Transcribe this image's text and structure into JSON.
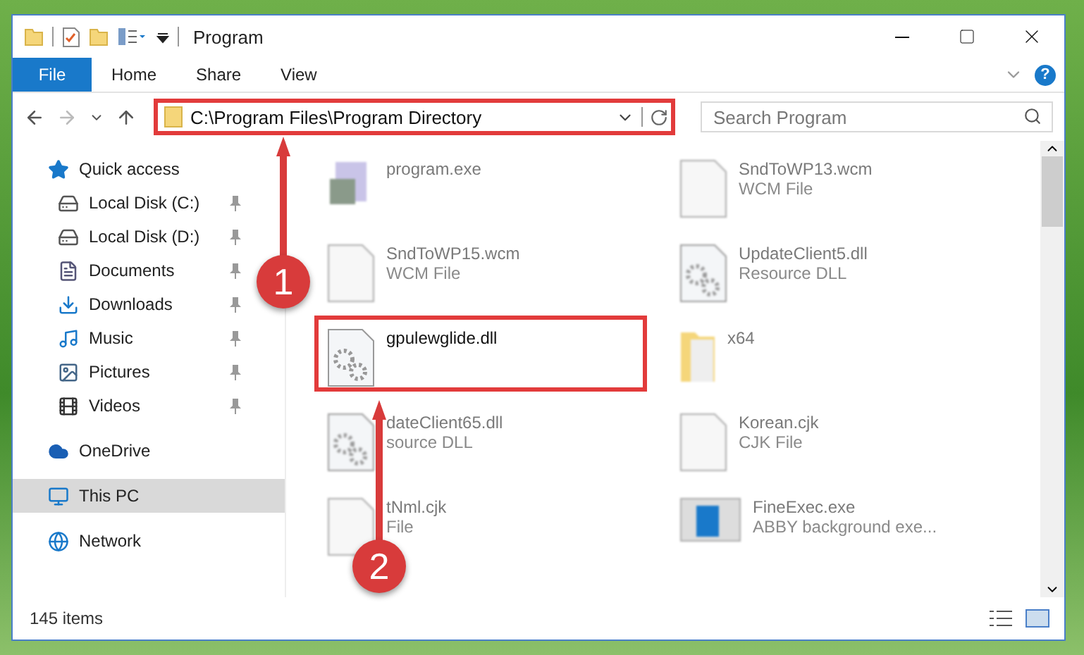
{
  "window": {
    "title": "Program"
  },
  "ribbon": {
    "tabs": [
      {
        "label": "File",
        "selected": true
      },
      {
        "label": "Home",
        "selected": false
      },
      {
        "label": "Share",
        "selected": false
      },
      {
        "label": "View",
        "selected": false
      }
    ],
    "help": "?"
  },
  "address": {
    "path": "C:\\Program Files\\Program Directory",
    "highlighted": true
  },
  "search": {
    "placeholder": "Search Program"
  },
  "nav": [
    {
      "label": "Quick access",
      "kind": "star",
      "selected": false,
      "children": [
        {
          "label": "Local Disk (C:)",
          "kind": "drive-c",
          "pinned": true
        },
        {
          "label": "Local Disk (D:)",
          "kind": "drive",
          "pinned": true
        },
        {
          "label": "Documents",
          "kind": "documents",
          "pinned": true
        },
        {
          "label": "Downloads",
          "kind": "downloads",
          "pinned": true
        },
        {
          "label": "Music",
          "kind": "music",
          "pinned": true
        },
        {
          "label": "Pictures",
          "kind": "pictures",
          "pinned": true
        },
        {
          "label": "Videos",
          "kind": "videos",
          "pinned": true
        }
      ]
    },
    {
      "label": "OneDrive",
      "kind": "cloud",
      "selected": false
    },
    {
      "label": "This PC",
      "kind": "pc",
      "selected": true
    },
    {
      "label": "Network",
      "kind": "network",
      "selected": false
    }
  ],
  "files": [
    {
      "name": "program.exe",
      "kind": "exe",
      "highlighted": false,
      "blurred": true
    },
    {
      "name": "SndToWP13.wcm",
      "type": "WCM File",
      "kind": "file",
      "highlighted": false,
      "blurred": true
    },
    {
      "name": "SndToWP15.wcm",
      "type": "WCM File",
      "kind": "file",
      "highlighted": false,
      "blurred": true
    },
    {
      "name": "UpdateClient5.dll",
      "type": "Resource DLL",
      "kind": "dll",
      "highlighted": false,
      "blurred": true
    },
    {
      "name": "gpulewglide.dll",
      "kind": "dll",
      "highlighted": true,
      "blurred": false
    },
    {
      "name": "x64",
      "kind": "folder",
      "highlighted": false,
      "blurred": true
    },
    {
      "name": "dateClient65.dll",
      "type": "source DLL",
      "kind": "dll",
      "highlighted": false,
      "blurred": true
    },
    {
      "name": "Korean.cjk",
      "type": "CJK File",
      "kind": "file",
      "highlighted": false,
      "blurred": true
    },
    {
      "name": "tNml.cjk",
      "type": "File",
      "kind": "file",
      "highlighted": false,
      "blurred": true
    },
    {
      "name": "FineExec.exe",
      "type": "ABBY background exe...",
      "kind": "app",
      "highlighted": false,
      "blurred": true
    }
  ],
  "status_bar": {
    "count": "145 items"
  },
  "annotations": [
    {
      "number": "1"
    },
    {
      "number": "2"
    }
  ]
}
